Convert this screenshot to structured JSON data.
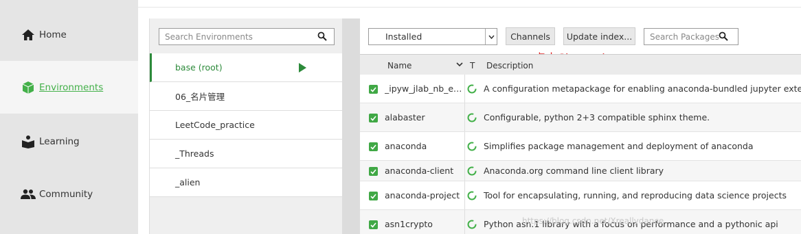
{
  "nav": {
    "items": [
      {
        "label": "Home",
        "icon": "home-icon"
      },
      {
        "label": "Environments",
        "icon": "cube-icon",
        "active": true
      },
      {
        "label": "Learning",
        "icon": "book-icon"
      },
      {
        "label": "Community",
        "icon": "people-icon"
      }
    ]
  },
  "environments": {
    "search_placeholder": "Search Environments",
    "items": [
      {
        "label": "base (root)",
        "active": true
      },
      {
        "label": "06_名片管理"
      },
      {
        "label": "LeetCode_practice"
      },
      {
        "label": "_Threads"
      },
      {
        "label": "_alien"
      }
    ]
  },
  "packages": {
    "filter_selected": "Installed",
    "channels_label": "Channels",
    "update_label": "Update index...",
    "search_placeholder": "Search Packages",
    "annotation": "点击Channels",
    "columns": {
      "name": "Name",
      "type": "T",
      "description": "Description"
    },
    "rows": [
      {
        "name": "_ipyw_jlab_nb_ext_conf",
        "description": "A configuration metapackage for enabling anaconda-bundled jupyter extensions"
      },
      {
        "name": "alabaster",
        "description": "Configurable, python 2+3 compatible sphinx theme."
      },
      {
        "name": "anaconda",
        "description": "Simplifies package management and deployment of anaconda"
      },
      {
        "name": "anaconda-client",
        "description": "Anaconda.org command line client library"
      },
      {
        "name": "anaconda-project",
        "description": "Tool for encapsulating, running, and reproducing data science projects"
      },
      {
        "name": "asn1crypto",
        "description": "Python asn.1 library with a focus on performance and a pythonic api"
      }
    ],
    "watermark": "https://blog.csdn.net/Xreallydance"
  },
  "colors": {
    "accent": "#43b049",
    "active_env": "#2c8a3a",
    "annotation": "#e02020"
  }
}
